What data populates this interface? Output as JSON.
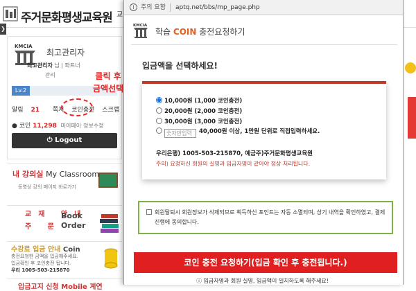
{
  "site": {
    "title": "주거문화평생교육원",
    "gnb_fragment": "교"
  },
  "profile": {
    "name": "최고관리자",
    "sub_line_bold": "최고관리자",
    "sub_line_rest": "님  | 파트너",
    "sub_line2": "관리",
    "level": "Lv.2",
    "menu": {
      "alarm_label": "알림",
      "alarm_count": "21",
      "note_label": "쪽지",
      "coin_charge_label": "코인충전",
      "scrap_label": "스크랩"
    },
    "coin_label": "코인",
    "coin_value": "11,298",
    "mypage_label": "마이페이",
    "edit_label": "정보수정",
    "logout_label": "Logout"
  },
  "annotation": {
    "line1": "클릭 후",
    "line2": "금액선택"
  },
  "sidebar": {
    "classroom_title_kr": "내 강의실",
    "classroom_title_en": "My Classroom",
    "classroom_sub": "등영상 강의 페이지 바로가기",
    "book_left": "교재 안내 / 주 문",
    "book_left_line1": "교재 안내",
    "book_left_line2": "주   문",
    "book_right_line1": "Book",
    "book_right_line2": "Order",
    "coin_title_kr": "수강료 입금 안내",
    "coin_title_en": "Coin",
    "coin_desc_line1": "충전요청한 금액을 입금해주세요.",
    "coin_desc_line2": "입금확인 후 코인충전 됩니다.",
    "coin_desc_line3": "우리 1005-503-215870",
    "bottom_title": "입금고지 신청  Mobile  계연"
  },
  "popup": {
    "secure_label": "주의 요함",
    "url": "aptq.net/bbs/mp_page.php",
    "title_prefix": "학습",
    "title_coin": "COIN",
    "title_suffix": "충전요청하기",
    "heading": "입금액을 선택하세요!",
    "options": [
      {
        "amount": "10,000원",
        "desc": "(1,000 코인충전)",
        "selected": true
      },
      {
        "amount": "20,000원",
        "desc": "(2,000 코인충전)",
        "selected": false
      },
      {
        "amount": "30,000원",
        "desc": "(3,000 코인충전)",
        "selected": false
      }
    ],
    "custom_placeholder": "숫자만입력",
    "custom_desc": "40,000원 이상, 1만원 단위로 직접입력하세요.",
    "bank_info": "우리은행) 1005-503-215870, 예금주)주거문화평생교육원",
    "notice": "주의) 요청하신 회원의 실명과 입금자명이 같아야 정상 처리됩니다.",
    "agree_text": "회원탈퇴시 회원정보가 삭제되므로 획득하신 포인트는 자동 소멸되며, 상기 내역을 확인하였고, 결제진행에 동의합니다.",
    "submit_label": "코인 충전 요청하기(입금 확인 후 충전됩니다.)",
    "footer_note": "입금자명과 회원 실명, 입금액이 일치하도록 해주세요!"
  }
}
